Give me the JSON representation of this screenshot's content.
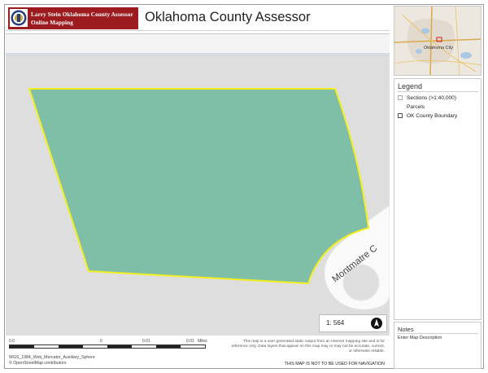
{
  "header": {
    "logo_line1": "Larry Stein Oklahoma County Assessor",
    "logo_line2": "Online Mapping",
    "title": "Oklahoma County Assessor"
  },
  "map": {
    "street_label": "Montmatre C",
    "parcel_fill": "#7fbfa8",
    "parcel_outline": "#f2ee20",
    "scale_text": "1: 564",
    "north_icon": "north-arrow-icon"
  },
  "scalebar": {
    "ticks": [
      "0.0",
      "0",
      "0.01",
      "0.01",
      "Miles"
    ],
    "projection": "WGS_1984_Web_Mercator_Auxiliary_Sphere",
    "attribution": "© OpenStreetMap contributors"
  },
  "disclaimer": "This map is a user generated static output from an Internet mapping site and is for reference only. Data layers that appear on this map may or may not be accurate, current, or otherwise reliable.",
  "nav_warning": "THIS MAP IS NOT TO BE USED FOR NAVIGATION",
  "overview": {
    "city_label": "Oklahoma City"
  },
  "legend": {
    "title": "Legend",
    "items": [
      {
        "label": "Sections (>1:40,000)"
      },
      {
        "label": "Parcels"
      },
      {
        "label": "OK County Boundary"
      }
    ]
  },
  "notes": {
    "title": "Notes",
    "description": "Enter Map Description"
  }
}
